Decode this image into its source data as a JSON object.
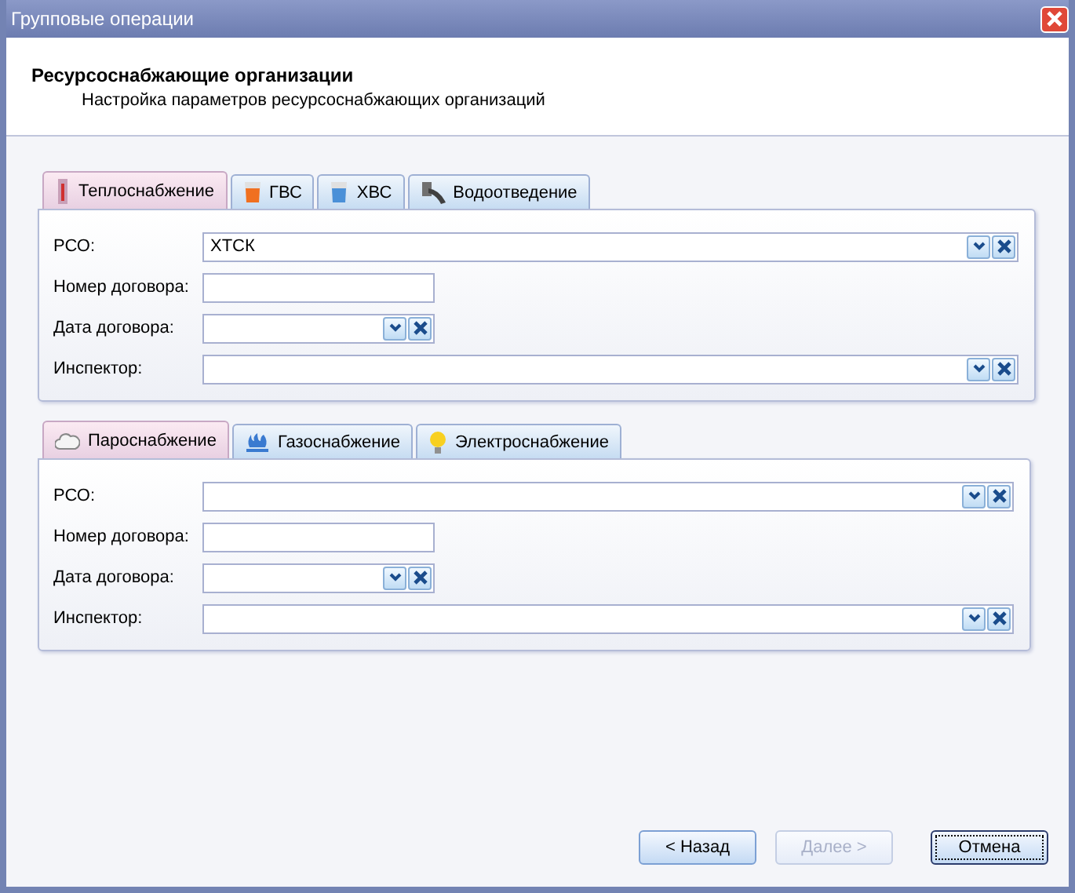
{
  "window": {
    "title": "Групповые операции"
  },
  "header": {
    "title": "Ресурсоснабжающие организации",
    "subtitle": "Настройка параметров ресурсоснабжающих организаций"
  },
  "groups": [
    {
      "tabs": [
        {
          "label": "Теплоснабжение",
          "selected": true
        },
        {
          "label": "ГВС",
          "selected": false
        },
        {
          "label": "ХВС",
          "selected": false
        },
        {
          "label": "Водоотведение",
          "selected": false
        }
      ],
      "fields": [
        {
          "label": "РСО:",
          "kind": "combo",
          "value": "ХТСК"
        },
        {
          "label": "Номер договора:",
          "kind": "text"
        },
        {
          "label": "Дата договора:",
          "kind": "date"
        },
        {
          "label": "Инспектор:",
          "kind": "combo"
        }
      ]
    },
    {
      "tabs": [
        {
          "label": "Пароснабжение",
          "selected": true
        },
        {
          "label": "Газоснабжение",
          "selected": false
        },
        {
          "label": "Электроснабжение",
          "selected": false
        }
      ],
      "fields": [
        {
          "label": "РСО:",
          "kind": "combo"
        },
        {
          "label": "Номер договора:",
          "kind": "text"
        },
        {
          "label": "Дата договора:",
          "kind": "date"
        },
        {
          "label": "Инспектор:",
          "kind": "combo"
        }
      ]
    }
  ],
  "buttons": [
    {
      "label": "< Назад",
      "disabled": false,
      "default": false
    },
    {
      "label": "Далее >",
      "disabled": true,
      "default": false
    },
    {
      "label": "Отмена",
      "disabled": false,
      "default": true
    }
  ]
}
